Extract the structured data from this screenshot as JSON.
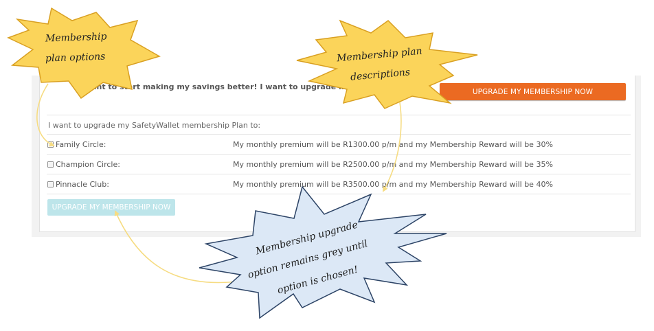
{
  "promo": {
    "text": "I want to start making my savings better! I want to upgrade my",
    "button_label": "UPGRADE MY MEMBERSHIP NOW"
  },
  "upgrade_form": {
    "label": "I want to upgrade my SafetyWallet membership Plan to:",
    "plans": [
      {
        "name": "Family Circle:",
        "description": "My monthly premium will be R1300.00 p/m and my Membership Reward will be 30%",
        "checked": false
      },
      {
        "name": "Champion Circle:",
        "description": "My monthly premium will be R2500.00 p/m and my Membership Reward will be 35%",
        "checked": false
      },
      {
        "name": "Pinnacle Club:",
        "description": "My monthly premium will be R3500.00 p/m and my Membership Reward will be 40%",
        "checked": false
      }
    ],
    "submit_label": "UPGRADE MY MEMBERSHIP NOW",
    "submit_disabled": true
  },
  "callouts": {
    "plan_options": {
      "line1": "Membership",
      "line2": "plan options"
    },
    "plan_descriptions": {
      "line1": "Membership plan",
      "line2": "descriptions"
    },
    "upgrade_note": {
      "line1": "Membership upgrade",
      "line2": "option remains grey until",
      "line3": "option is chosen!"
    }
  },
  "colors": {
    "accent_orange": "#eb6a22",
    "disabled_button": "#bde5ea",
    "callout_yellow": "#fbd45a",
    "callout_blue": "#dce8f6",
    "arrow": "#f6dc82"
  },
  "icons": [
    "checkbox-icon",
    "starburst-callout",
    "curved-arrow"
  ]
}
